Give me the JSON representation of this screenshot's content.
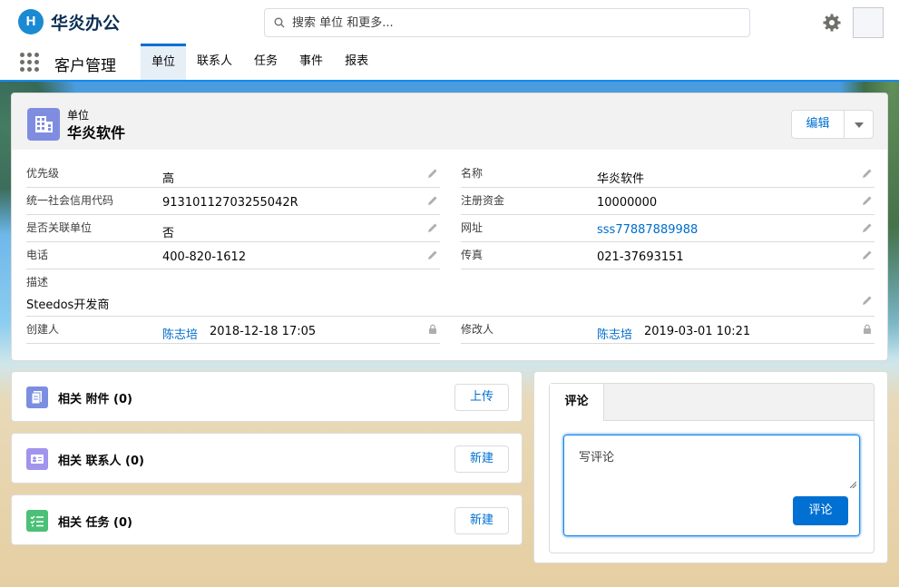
{
  "header": {
    "brand": "华炎办公",
    "search": {
      "placeholder": "搜索 单位 和更多..."
    },
    "app_name": "客户管理",
    "tabs": [
      {
        "label": "单位",
        "active": true
      },
      {
        "label": "联系人",
        "active": false
      },
      {
        "label": "任务",
        "active": false
      },
      {
        "label": "事件",
        "active": false
      },
      {
        "label": "报表",
        "active": false
      }
    ]
  },
  "record": {
    "object_type": "单位",
    "name": "华炎软件",
    "actions": {
      "edit": "编辑"
    },
    "fields": {
      "priority": {
        "label": "优先级",
        "value": "高"
      },
      "name": {
        "label": "名称",
        "value": "华炎软件"
      },
      "credit_code": {
        "label": "统一社会信用代码",
        "value": "91310112703255042R"
      },
      "capital": {
        "label": "注册资金",
        "value": "10000000"
      },
      "related": {
        "label": "是否关联单位",
        "value": "否"
      },
      "website": {
        "label": "网址",
        "value": "sss77887889988"
      },
      "phone": {
        "label": "电话",
        "value": "400-820-1612"
      },
      "fax": {
        "label": "传真",
        "value": "021-37693151"
      },
      "description": {
        "label": "描述",
        "value": "Steedos开发商"
      },
      "created_by": {
        "label": "创建人",
        "user": "陈志培",
        "date": "2018-12-18 17:05"
      },
      "modified_by": {
        "label": "修改人",
        "user": "陈志培",
        "date": "2019-03-01 10:21"
      }
    }
  },
  "related": [
    {
      "title": "相关 附件 (0)",
      "button": "上传",
      "color": "#7b8fe0"
    },
    {
      "title": "相关 联系人 (0)",
      "button": "新建",
      "color": "#a094ed"
    },
    {
      "title": "相关 任务 (0)",
      "button": "新建",
      "color": "#4bc076"
    }
  ],
  "comments": {
    "tab": "评论",
    "placeholder": "写评论",
    "submit": "评论"
  },
  "colors": {
    "brand": "#0070d2",
    "link": "#006dcc",
    "object_icon": "#7f8de1"
  }
}
